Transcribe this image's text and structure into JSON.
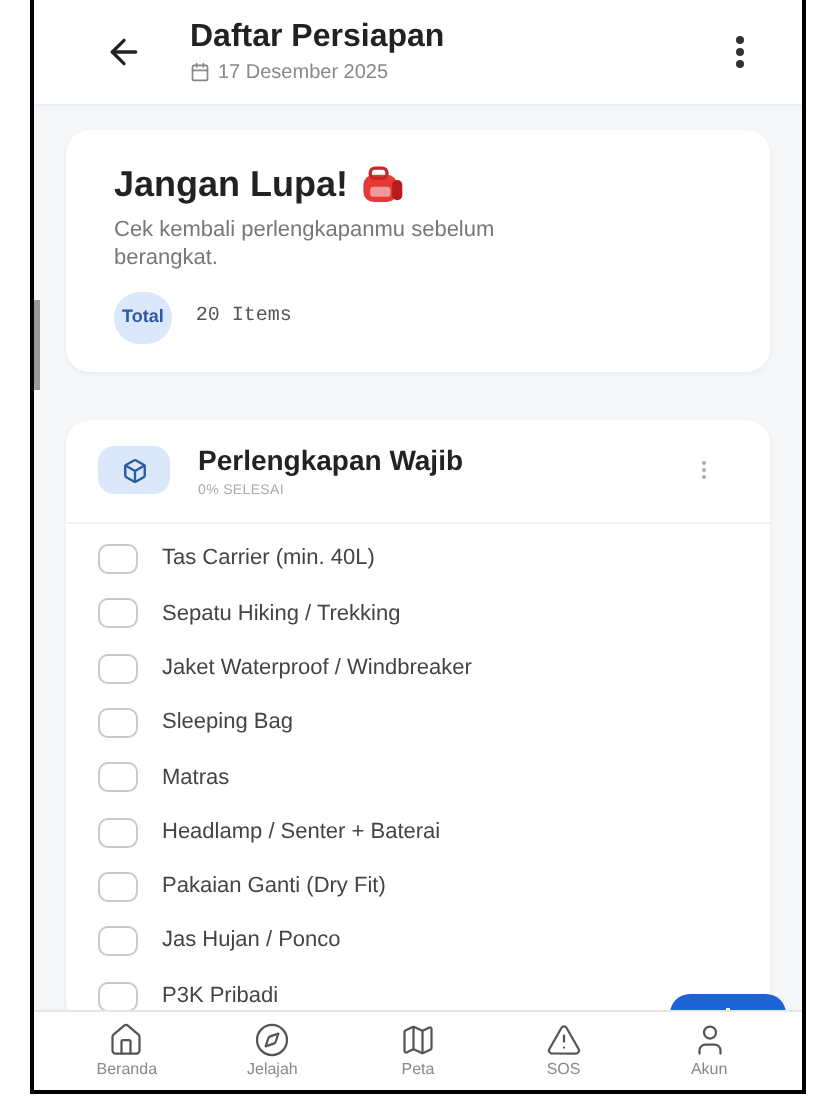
{
  "header": {
    "title": "Daftar Persiapan",
    "date": "17 Desember 2025"
  },
  "summary": {
    "title": "Jangan Lupa!",
    "description": "Cek kembali perlengkapanmu sebelum berangkat.",
    "total_label": "Total",
    "total_value": "20 Items"
  },
  "category": {
    "title": "Perlengkapan Wajib",
    "progress": "0% SELESAI",
    "items": [
      {
        "label": "Tas Carrier (min. 40L)",
        "checked": false
      },
      {
        "label": "Sepatu Hiking / Trekking",
        "checked": false
      },
      {
        "label": "Jaket Waterproof / Windbreaker",
        "checked": false
      },
      {
        "label": "Sleeping Bag",
        "checked": false
      },
      {
        "label": "Matras",
        "checked": false
      },
      {
        "label": "Headlamp / Senter + Baterai",
        "checked": false
      },
      {
        "label": "Pakaian Ganti (Dry Fit)",
        "checked": false
      },
      {
        "label": "Jas Hujan / Ponco",
        "checked": false
      },
      {
        "label": "P3K Pribadi",
        "checked": false
      }
    ]
  },
  "bottom_nav": [
    {
      "label": "Beranda",
      "kind": "home",
      "selected": false
    },
    {
      "label": "Jelajah",
      "kind": "explore",
      "selected": false
    },
    {
      "label": "Peta",
      "kind": "map",
      "selected": false
    },
    {
      "label": "SOS",
      "kind": "alert",
      "selected": false
    },
    {
      "label": "Akun",
      "kind": "user",
      "selected": false
    }
  ]
}
